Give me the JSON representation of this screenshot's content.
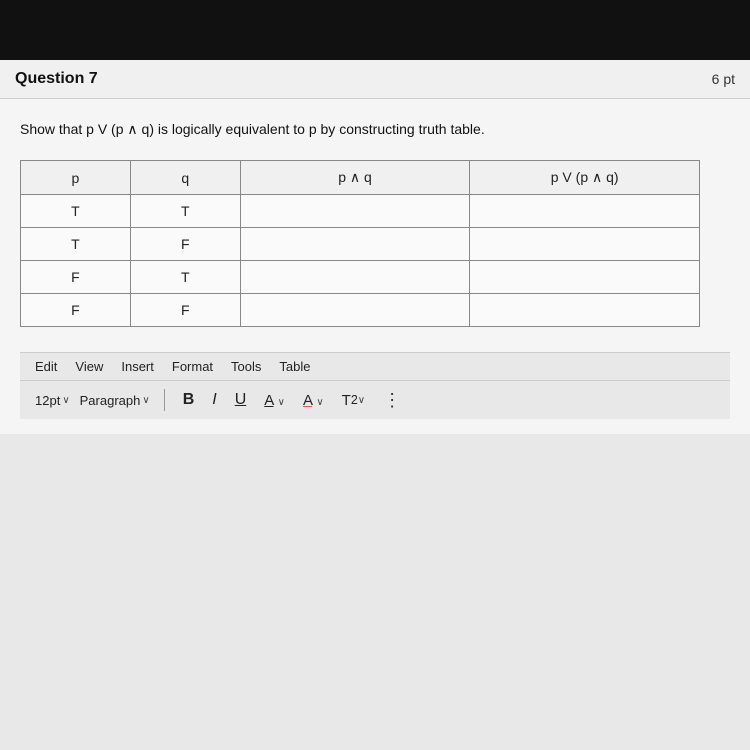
{
  "header": {
    "question_label": "Question 7",
    "points_label": "6 pt"
  },
  "content": {
    "question_text": "Show that p V (p  ∧ q) is logically equivalent to p by constructing truth table."
  },
  "table": {
    "headers": [
      "p",
      "q",
      "p ∧ q",
      "p V (p ∧ q)"
    ],
    "rows": [
      [
        "T",
        "T",
        "",
        ""
      ],
      [
        "T",
        "F",
        "",
        ""
      ],
      [
        "F",
        "T",
        "",
        ""
      ],
      [
        "F",
        "F",
        "",
        ""
      ]
    ]
  },
  "menu": {
    "items": [
      "Edit",
      "View",
      "Insert",
      "Format",
      "Tools",
      "Table"
    ]
  },
  "toolbar": {
    "font_size": "12pt",
    "font_size_chevron": "∨",
    "paragraph": "Paragraph",
    "paragraph_chevron": "∨",
    "bold": "B",
    "italic": "I",
    "underline": "U",
    "font_color": "A",
    "highlight": "A",
    "superscript": "T²",
    "more": "⋮"
  }
}
